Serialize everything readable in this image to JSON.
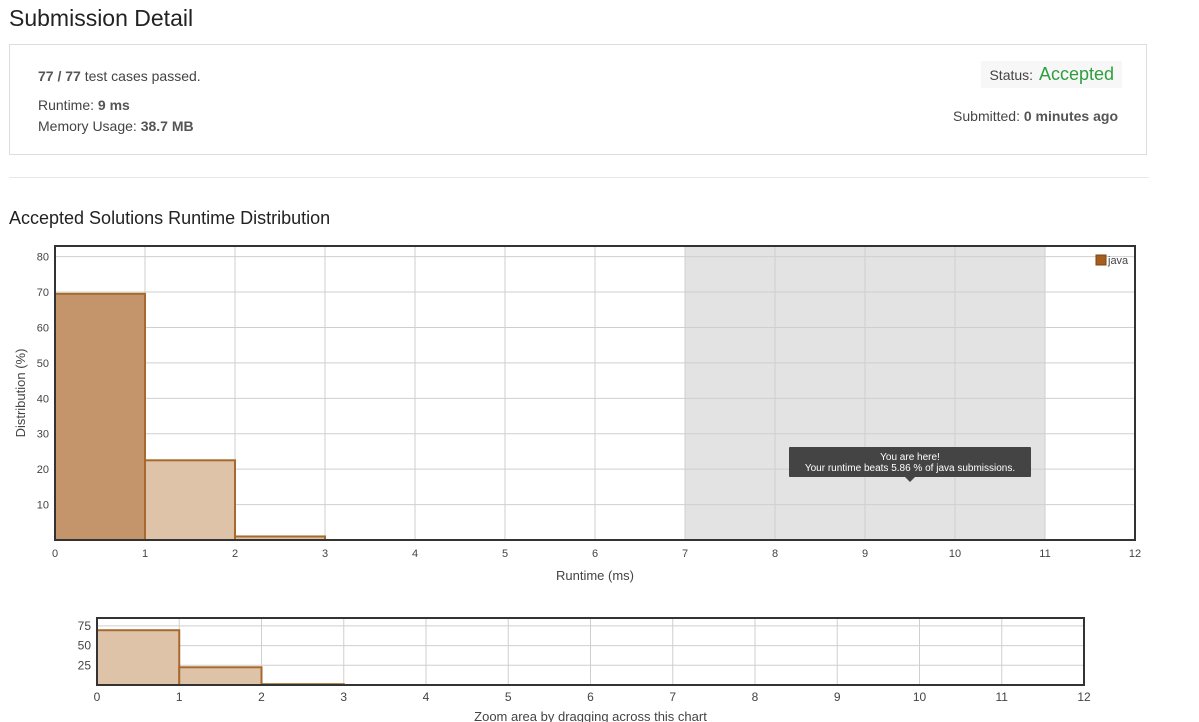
{
  "page": {
    "title": "Submission Detail"
  },
  "summary": {
    "cases_bold": "77 / 77",
    "cases_text": " test cases passed.",
    "runtime_label": "Runtime: ",
    "runtime_value": "9 ms",
    "memory_label": "Memory Usage: ",
    "memory_value": "38.7 MB",
    "status_label": "Status: ",
    "status_value": "Accepted",
    "submitted_label": "Submitted: ",
    "submitted_value": "0 minutes ago"
  },
  "section": {
    "title": "Accepted Solutions Runtime Distribution"
  },
  "colors": {
    "bar_fill_main_first": "#c4956a",
    "bar_fill_light": "#dfc3a8",
    "bar_stroke": "#a86a2c",
    "highlight_band": "#e3e3e3",
    "status_green": "#2e9e3e",
    "legend_swatch": "#a65e1f",
    "tooltip_bg": "#444444"
  },
  "tooltip": {
    "line1": "You are here!",
    "line2": "Your runtime beats 5.86 % of java submissions."
  },
  "zoom_caption": "Zoom area by dragging across this chart",
  "chart_data": [
    {
      "type": "bar",
      "name": "main",
      "x_bins": [
        [
          0,
          1
        ],
        [
          1,
          2
        ],
        [
          2,
          3
        ]
      ],
      "series": [
        {
          "name": "java",
          "values": [
            69.5,
            22.5,
            1.0
          ]
        }
      ],
      "xlabel": "Runtime (ms)",
      "ylabel": "Distribution (%)",
      "xlim": [
        0,
        12
      ],
      "ylim": [
        0,
        83
      ],
      "x_ticks": [
        "0",
        "1",
        "2",
        "3",
        "4",
        "5",
        "6",
        "7",
        "8",
        "9",
        "10",
        "11",
        "12"
      ],
      "y_ticks": [
        "10",
        "20",
        "30",
        "40",
        "50",
        "60",
        "70",
        "80"
      ],
      "highlight_range": [
        7,
        11
      ],
      "grid": true,
      "legend": "top-right"
    },
    {
      "type": "bar",
      "name": "overview",
      "x_bins": [
        [
          0,
          1
        ],
        [
          1,
          2
        ],
        [
          2,
          3
        ]
      ],
      "series": [
        {
          "name": "java",
          "values": [
            69.5,
            22.5,
            1.0
          ]
        }
      ],
      "xlim": [
        0,
        12
      ],
      "ylim": [
        0,
        85
      ],
      "x_ticks": [
        "0",
        "1",
        "2",
        "3",
        "4",
        "5",
        "6",
        "7",
        "8",
        "9",
        "10",
        "11",
        "12"
      ],
      "y_ticks": [
        "25",
        "50",
        "75"
      ],
      "grid": true
    }
  ]
}
